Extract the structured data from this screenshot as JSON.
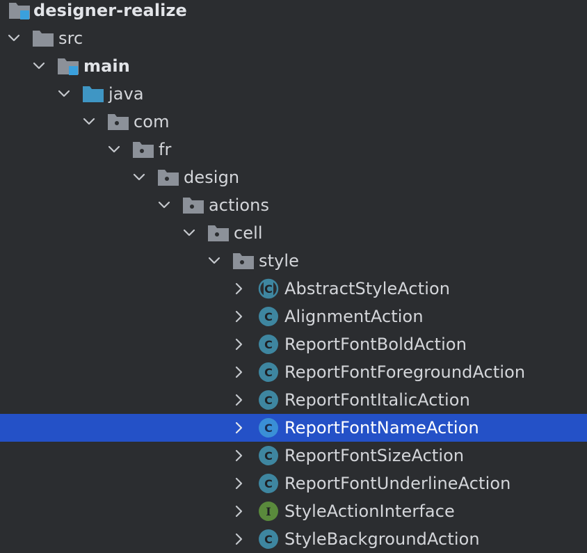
{
  "project": {
    "root_label": "designer-realize",
    "nodes": [
      {
        "label": "src",
        "icon": "folder-icon",
        "expanded": true
      },
      {
        "label": "main",
        "icon": "source-root-folder-icon",
        "expanded": true
      },
      {
        "label": "java",
        "icon": "java-source-folder-icon",
        "expanded": true
      },
      {
        "label": "com",
        "icon": "package-icon",
        "expanded": true
      },
      {
        "label": "fr",
        "icon": "package-icon",
        "expanded": true
      },
      {
        "label": "design",
        "icon": "package-icon",
        "expanded": true
      },
      {
        "label": "actions",
        "icon": "package-icon",
        "expanded": true
      },
      {
        "label": "cell",
        "icon": "package-icon",
        "expanded": true
      },
      {
        "label": "style",
        "icon": "package-icon",
        "expanded": true
      },
      {
        "label": "AbstractStyleAction",
        "icon": "abstract-class-icon",
        "expanded": false
      },
      {
        "label": "AlignmentAction",
        "icon": "class-icon",
        "expanded": false
      },
      {
        "label": "ReportFontBoldAction",
        "icon": "class-icon",
        "expanded": false
      },
      {
        "label": "ReportFontForegroundAction",
        "icon": "class-icon",
        "expanded": false
      },
      {
        "label": "ReportFontItalicAction",
        "icon": "class-icon",
        "expanded": false
      },
      {
        "label": "ReportFontNameAction",
        "icon": "class-icon",
        "expanded": false,
        "selected": true
      },
      {
        "label": "ReportFontSizeAction",
        "icon": "class-icon",
        "expanded": false
      },
      {
        "label": "ReportFontUnderlineAction",
        "icon": "class-icon",
        "expanded": false
      },
      {
        "label": "StyleActionInterface",
        "icon": "interface-icon",
        "expanded": false
      },
      {
        "label": "StyleBackgroundAction",
        "icon": "class-icon",
        "expanded": false
      }
    ]
  },
  "colors": {
    "background": "#2b2d30",
    "selection": "#2451c7",
    "folder": "#8c9199",
    "source_root": "#4aa8d8",
    "class_icon": "#3e86a0",
    "interface_icon": "#5a8a3c"
  }
}
